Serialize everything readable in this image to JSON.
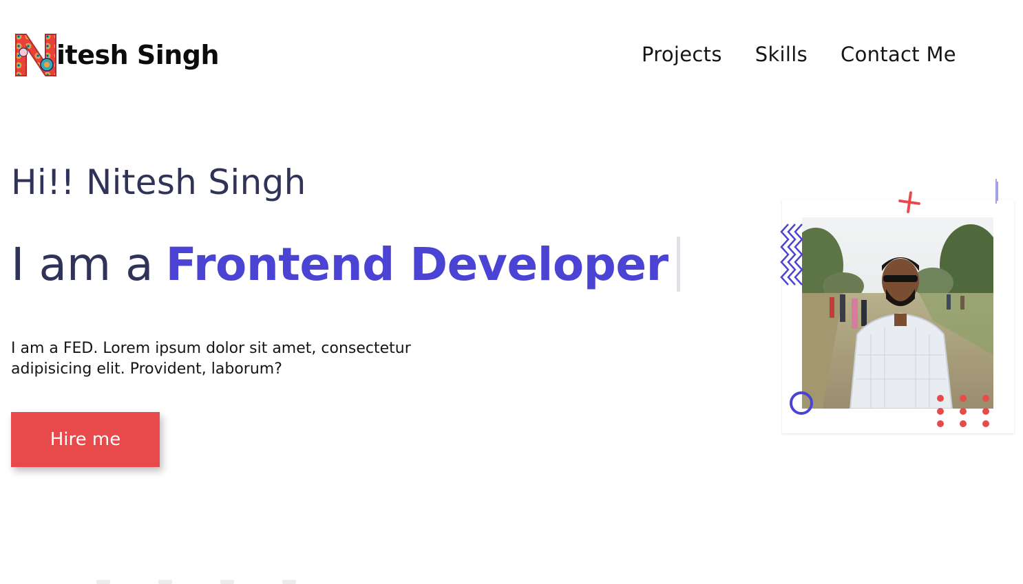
{
  "brand": {
    "name": "itesh Singh",
    "logo_icon": "decorated-letter-n-icon",
    "colors": {
      "accent": "#4a43d4",
      "cta": "#e84a4c",
      "heading": "#2f3358"
    }
  },
  "nav": {
    "items": [
      {
        "label": "Projects"
      },
      {
        "label": "Skills"
      },
      {
        "label": "Contact Me"
      }
    ]
  },
  "hero": {
    "greeting": "Hi!! Nitesh Singh",
    "headline_prefix": "I am a",
    "headline_role": "Frontend Developer",
    "intro": "I am a FED. Lorem ipsum dolor sit amet, consectetur adipisicing elit. Provident, laborum?",
    "cta_label": "Hire me"
  },
  "profile": {
    "photo_icon": "profile-photo",
    "decorations": [
      "plus-icon",
      "zigzag-icon",
      "circle-icon",
      "dot-grid-icon"
    ]
  }
}
